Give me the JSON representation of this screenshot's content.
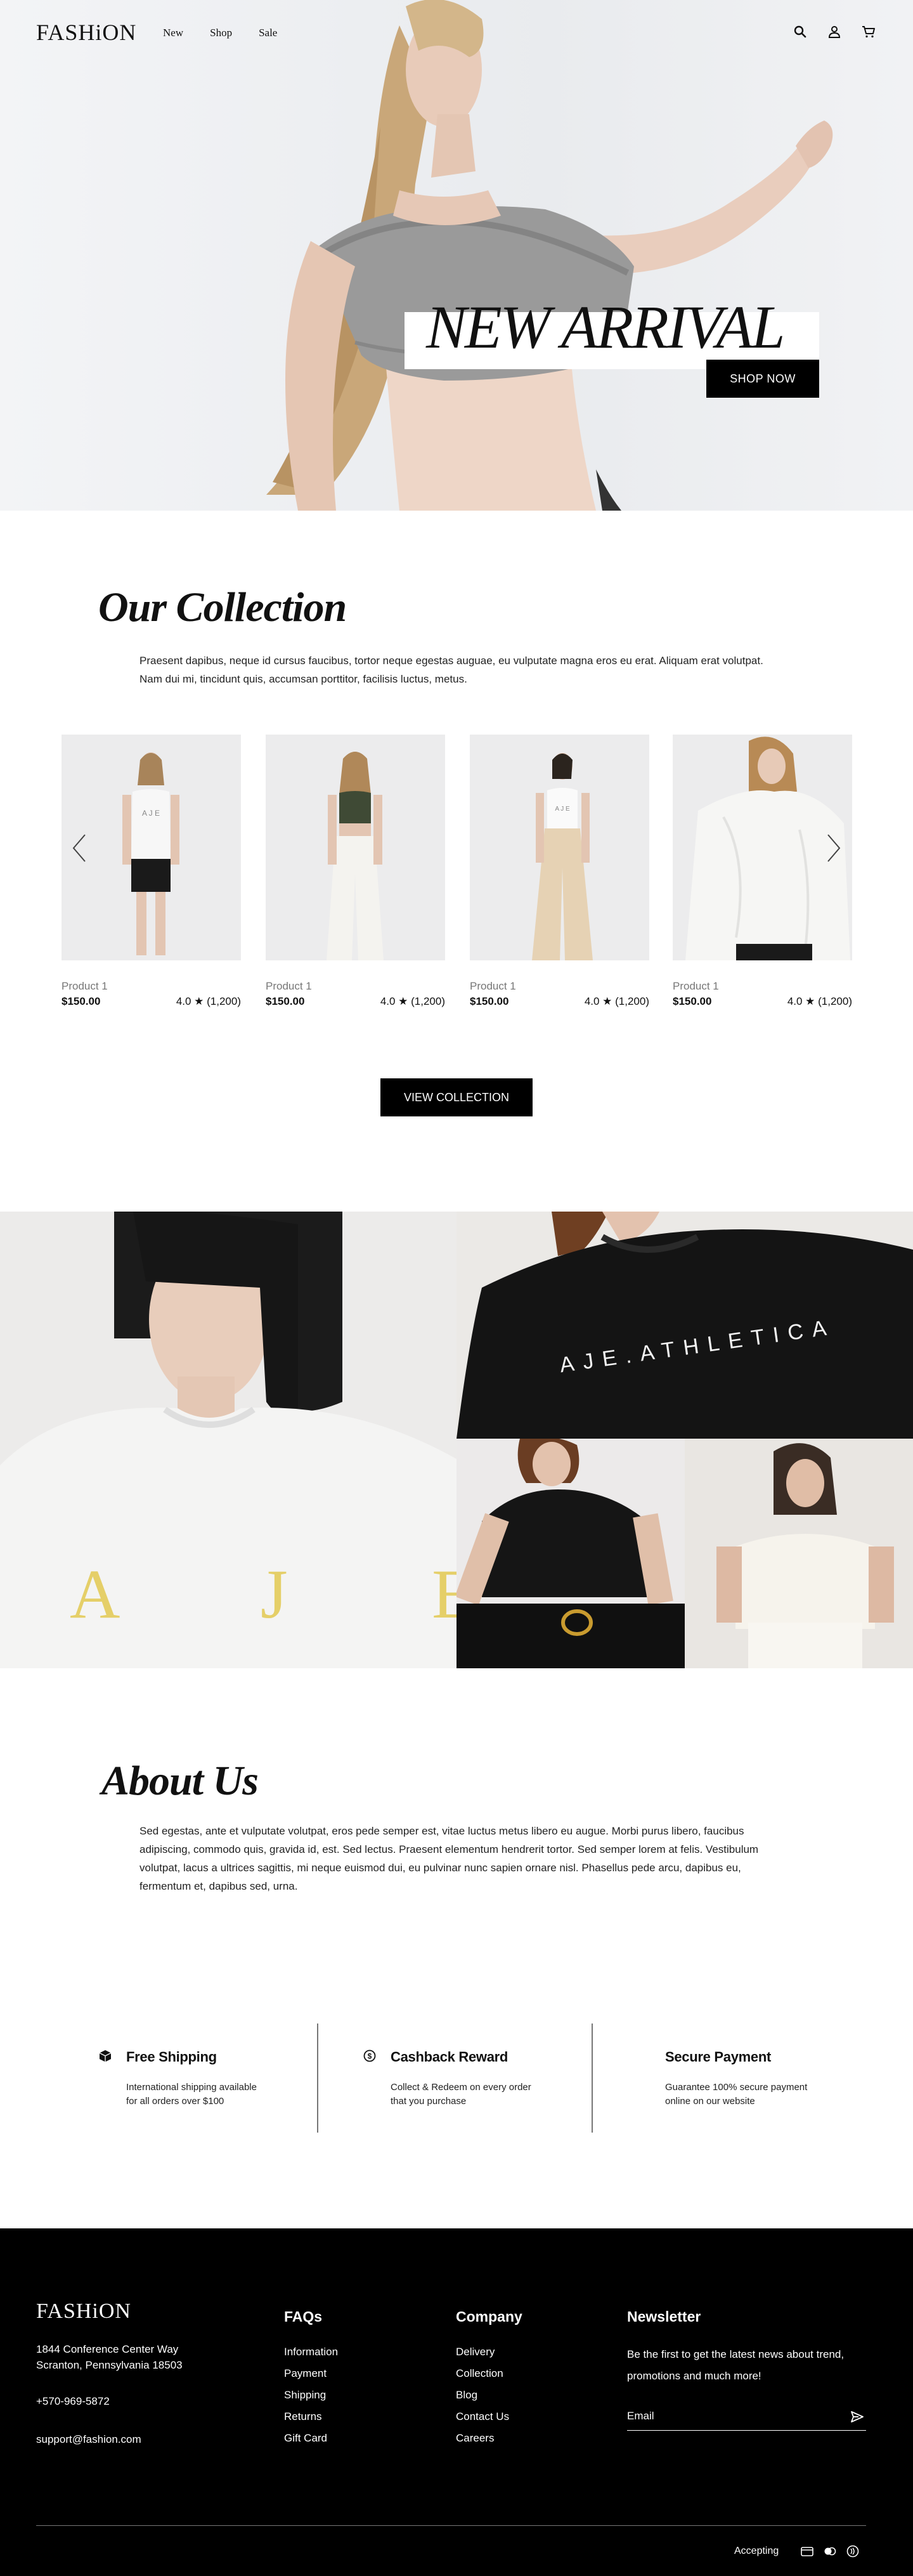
{
  "nav": {
    "logo": "FASHiON",
    "links": [
      "New",
      "Shop",
      "Sale"
    ],
    "icons": [
      "search-icon",
      "user-icon",
      "cart-icon"
    ]
  },
  "hero": {
    "title": "NEW ARRIVAL",
    "cta": "SHOP NOW"
  },
  "collection": {
    "title": "Our Collection",
    "description": "Praesent dapibus, neque id cursus faucibus, tortor neque egestas auguae, eu vulputate magna eros eu erat. Aliquam erat volutpat. Nam dui mi, tincidunt quis, accumsan porttitor, facilisis luctus, metus.",
    "products": [
      {
        "name": "Product 1",
        "price": "$150.00",
        "rating": "4.0 ★ (1,200)",
        "print": "A J E"
      },
      {
        "name": "Product 1",
        "price": "$150.00",
        "rating": "4.0 ★ (1,200)",
        "print": ""
      },
      {
        "name": "Product 1",
        "price": "$150.00",
        "rating": "4.0 ★ (1,200)",
        "print": "A J E"
      },
      {
        "name": "Product 1",
        "price": "$150.00",
        "rating": "4.0 ★ (1,200)",
        "print": ""
      }
    ],
    "cta": "VIEW COLLECTION"
  },
  "gallery": {
    "tshirt_print_1": "A J E",
    "tshirt_print_2": "AJE.ATHLETICA"
  },
  "about": {
    "title": "About Us",
    "text": "Sed egestas, ante et vulputate volutpat, eros pede semper est, vitae luctus metus libero eu augue. Morbi purus libero, faucibus adipiscing, commodo quis, gravida id, est. Sed lectus. Praesent elementum hendrerit tortor. Sed semper lorem at felis. Vestibulum volutpat, lacus a ultrices sagittis, mi neque euismod dui, eu pulvinar nunc sapien ornare nisl. Phasellus pede arcu, dapibus eu, fermentum et, dapibus sed, urna."
  },
  "features": [
    {
      "title": "Free Shipping",
      "line1": "International shipping available",
      "line2": "for all orders over $100",
      "icon": "box-icon"
    },
    {
      "title": "Cashback Reward",
      "line1": "Collect & Redeem on every order",
      "line2": "that you purchase",
      "icon": "dollar-circle-icon"
    },
    {
      "title": "Secure Payment",
      "line1": "Guarantee 100% secure payment",
      "line2": "online on our website",
      "icon": ""
    }
  ],
  "footer": {
    "logo": "FASHiON",
    "address_line1": "1844 Conference Center Way",
    "address_line2": "Scranton, Pennsylvania 18503",
    "phone": "+570-969-5872",
    "email": "support@fashion.com",
    "faqs": {
      "title": "FAQs",
      "items": [
        "Information",
        "Payment",
        "Shipping",
        "Returns",
        "Gift Card"
      ]
    },
    "company": {
      "title": "Company",
      "items": [
        "Delivery",
        "Collection",
        "Blog",
        "Contact Us",
        "Careers"
      ]
    },
    "newsletter": {
      "title": "Newsletter",
      "line1": "Be the first to get the latest news about trend,",
      "line2": "promotions and much more!",
      "placeholder": "Email"
    },
    "accepting": "Accepting",
    "payment_icons": [
      "card-icon",
      "mastercard-icon",
      "contactless-icon"
    ]
  }
}
